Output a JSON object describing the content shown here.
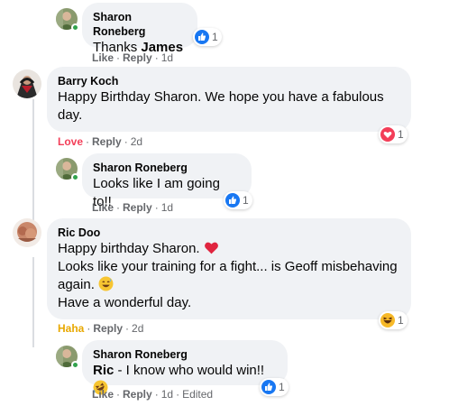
{
  "comments": [
    {
      "author": "Sharon Roneberg",
      "text": "Thanks ",
      "mention": "James",
      "actions": {
        "like": "Like",
        "reply": "Reply",
        "time": "1d"
      },
      "reaction": {
        "type": "like",
        "count": "1"
      }
    },
    {
      "author": "Barry Koch",
      "line1": "Happy Birthday Sharon. We hope you have a fabulous",
      "line2": "day.",
      "actions": {
        "like": "Love",
        "reply": "Reply",
        "time": "2d"
      },
      "reaction": {
        "type": "love",
        "count": "1"
      }
    },
    {
      "author": "Sharon Roneberg",
      "text": "Looks like I am going to!!",
      "actions": {
        "like": "Like",
        "reply": "Reply",
        "time": "1d"
      },
      "reaction": {
        "type": "like",
        "count": "1"
      }
    },
    {
      "author": "Ric Doo",
      "line1": "Happy birthday Sharon.",
      "line2": "Looks like your training for a fight... is Geoff misbehaving",
      "line3": "again.",
      "line4": "Have a wonderful day.",
      "actions": {
        "like": "Haha",
        "reply": "Reply",
        "time": "2d"
      },
      "reaction": {
        "type": "haha",
        "count": "1"
      }
    },
    {
      "author": "Sharon Roneberg",
      "mention": "Ric",
      "text": " - I know who would win!!",
      "actions": {
        "like": "Like",
        "reply": "Reply",
        "time": "1d",
        "edited": "Edited"
      },
      "reaction": {
        "type": "like",
        "count": "1"
      }
    }
  ],
  "colors": {
    "bubble": "#f0f2f5",
    "like_blue": "#1877f2",
    "love_red": "#f33e58",
    "haha_yellow": "#f7b928",
    "meta_gray": "#65676b"
  }
}
